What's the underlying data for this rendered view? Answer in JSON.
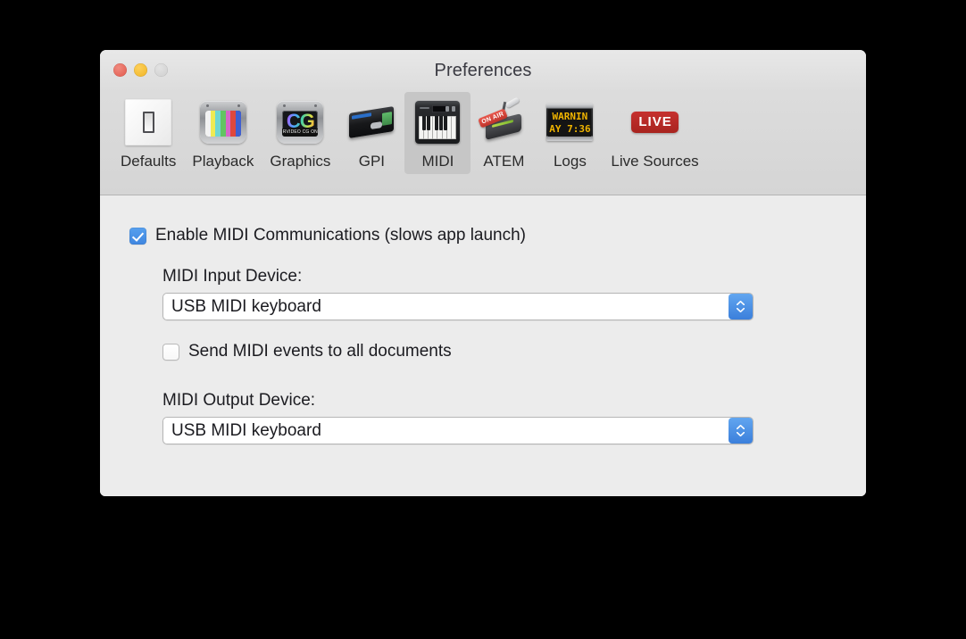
{
  "window": {
    "title": "Preferences",
    "traffic_lights": [
      {
        "name": "close",
        "color": "#e2574a"
      },
      {
        "name": "minimize",
        "color": "#f0b323"
      },
      {
        "name": "zoom",
        "color": "#cfcfcf"
      }
    ]
  },
  "toolbar": {
    "selected": "MIDI",
    "tabs": [
      {
        "label": "Defaults",
        "icon": "light-switch-icon"
      },
      {
        "label": "Playback",
        "icon": "crt-color-bars-icon"
      },
      {
        "label": "Graphics",
        "icon": "crt-cg-icon"
      },
      {
        "label": "GPI",
        "icon": "gpi-interface-box-icon"
      },
      {
        "label": "MIDI",
        "icon": "midi-keyboard-icon"
      },
      {
        "label": "ATEM",
        "icon": "on-air-switcher-icon"
      },
      {
        "label": "Logs",
        "icon": "led-sign-icon"
      },
      {
        "label": "Live Sources",
        "icon": "live-badge-icon"
      }
    ],
    "icon_text": {
      "graphics_cg": "CG",
      "graphics_ticker": "RVIDEO CG ON",
      "atem_onair": "ON AIR",
      "logs_line1": "WARNIN",
      "logs_line2": "AY 7:36",
      "live_badge": "LIVE"
    }
  },
  "midi_panel": {
    "enable_midi": {
      "label": "Enable MIDI Communications (slows app launch)",
      "checked": true
    },
    "input_device": {
      "label": "MIDI Input Device:",
      "value": "USB MIDI keyboard"
    },
    "send_to_all": {
      "label": "Send MIDI events to all documents",
      "checked": false
    },
    "output_device": {
      "label": "MIDI Output Device:",
      "value": "USB MIDI keyboard"
    }
  },
  "colors": {
    "accent_blue": "#4a90e2",
    "window_bg": "#ececec",
    "toolbar_bg": "#d8d8d8",
    "selected_tab_bg": "#c6c6c6",
    "live_red": "#c6312f",
    "led_amber": "#f0b400"
  }
}
